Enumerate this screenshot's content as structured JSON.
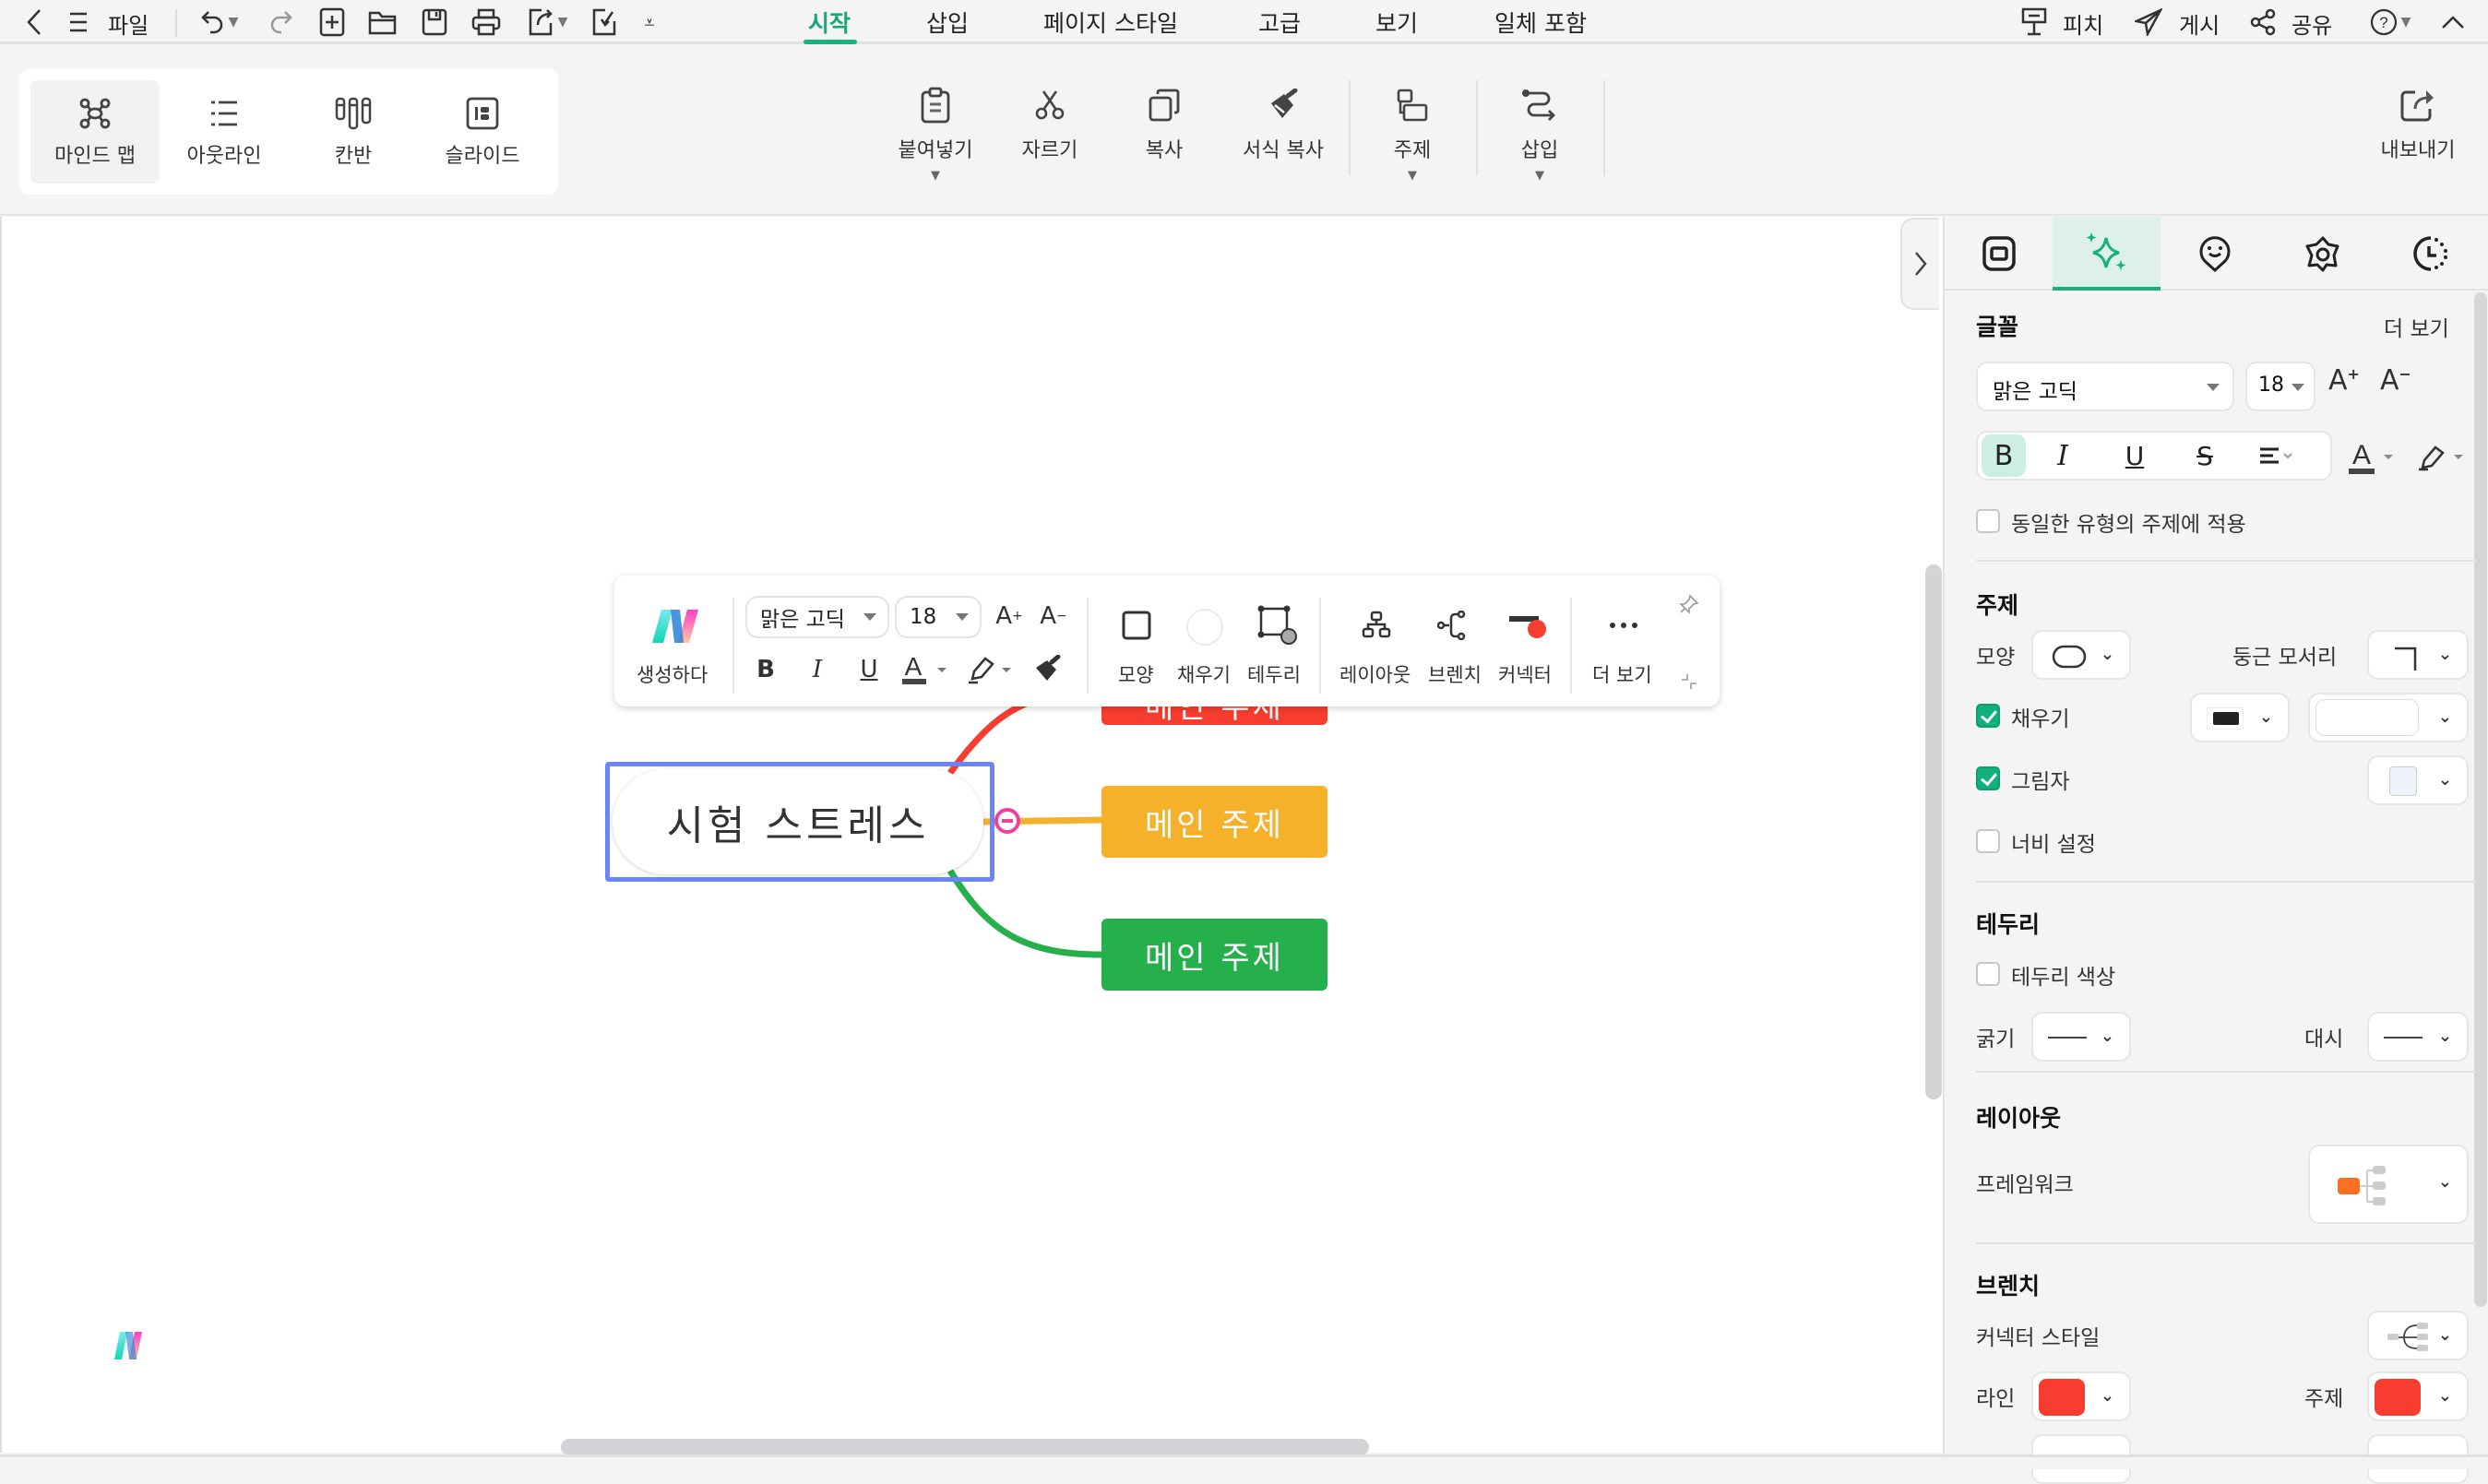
{
  "menubar": {
    "file_label": "파일",
    "tabs": [
      {
        "label": "시작",
        "active": true
      },
      {
        "label": "삽입",
        "active": false
      },
      {
        "label": "페이지 스타일",
        "active": false
      },
      {
        "label": "고급",
        "active": false
      },
      {
        "label": "보기",
        "active": false
      },
      {
        "label": "일체 포함",
        "active": false
      }
    ],
    "right": {
      "pitch": "피치",
      "publish": "게시",
      "share": "공유"
    }
  },
  "ribbon": {
    "views": [
      {
        "label": "마인드 맵",
        "icon": "mindmap-icon",
        "active": true
      },
      {
        "label": "아웃라인",
        "icon": "outline-icon",
        "active": false
      },
      {
        "label": "칸반",
        "icon": "kanban-icon",
        "active": false
      },
      {
        "label": "슬라이드",
        "icon": "slide-icon",
        "active": false
      }
    ],
    "actions": {
      "paste": "붙여넣기",
      "cut": "자르기",
      "copy": "복사",
      "format_painter": "서식 복사",
      "topic": "주제",
      "insert": "삽입",
      "export": "내보내기"
    }
  },
  "mindmap": {
    "central": "시험 스트레스",
    "branches": [
      {
        "label": "메인 주제",
        "color": "#f73d2f"
      },
      {
        "label": "메인 주제",
        "color": "#f5b12a"
      },
      {
        "label": "메인 주제",
        "color": "#26b04b"
      }
    ]
  },
  "floating_toolbar": {
    "ai_label": "생성하다",
    "font": "맑은 고딕",
    "size": "18",
    "shape": "모양",
    "fill": "채우기",
    "border": "테두리",
    "layout": "레이아웃",
    "branch": "브렌치",
    "connector": "커넥터",
    "more": "더 보기"
  },
  "panel": {
    "font_section": {
      "title": "글꼴",
      "more": "더 보기",
      "font": "맑은 고딕",
      "size": "18",
      "apply_same_type": "동일한 유형의 주제에 적용",
      "apply_same_type_checked": false
    },
    "topic_section": {
      "title": "주제",
      "shape_label": "모양",
      "corner_label": "둥근 모서리",
      "fill_label": "채우기",
      "fill_checked": true,
      "fill_color": "#222222",
      "shadow_label": "그림자",
      "shadow_checked": true,
      "shadow_color": "#eef3fb",
      "width_label": "너비 설정",
      "width_checked": false
    },
    "border_section": {
      "title": "테두리",
      "color_label": "테두리 색상",
      "color_checked": false,
      "weight_label": "굵기",
      "dash_label": "대시"
    },
    "layout_section": {
      "title": "레이아웃",
      "framework_label": "프레임워크"
    },
    "branch_section": {
      "title": "브렌치",
      "connector_style_label": "커넥터 스타일",
      "line_label": "라인",
      "line_color": "#f73d2f",
      "topic_label": "주제",
      "topic_color": "#f73d2f"
    }
  }
}
